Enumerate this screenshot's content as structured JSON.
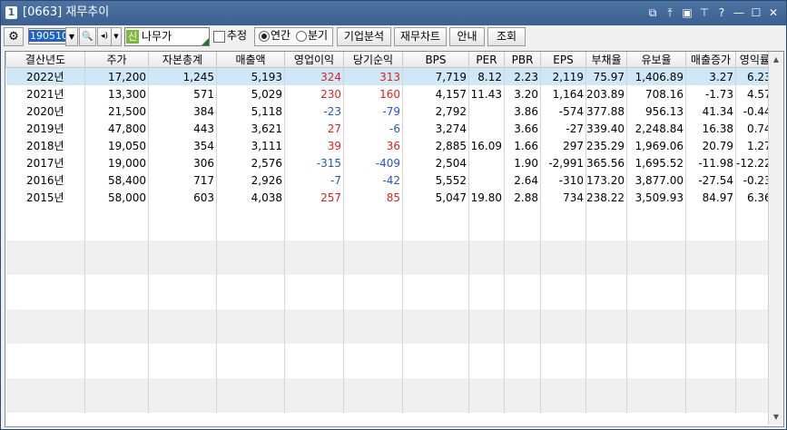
{
  "window": {
    "number": "1",
    "title": "[0663]  재무추이",
    "icons": [
      "⧉",
      "⤒",
      "▣",
      "⊤",
      "?",
      "—",
      "☐",
      "✕"
    ]
  },
  "toolbar": {
    "gear": "⚙",
    "stock_code": "190510",
    "dropdown": "▼",
    "search": "🔍",
    "sound": "◂)",
    "badge": "신",
    "stock_name": "나무가",
    "estimate_label": "추정",
    "annual_label": "연간",
    "quarter_label": "분기",
    "btn_company": "기업분석",
    "btn_chart": "재무차트",
    "btn_guide": "안내",
    "btn_query": "조회"
  },
  "table": {
    "headers": [
      "결산년도",
      "주가",
      "자본총계",
      "매출액",
      "영업이익",
      "당기순익",
      "BPS",
      "PER",
      "PBR",
      "EPS",
      "부채율",
      "유보율",
      "매출증가",
      "영익률"
    ],
    "rows": [
      {
        "year": "2022년",
        "price": "17,200",
        "equity": "1,245",
        "sales": "5,193",
        "op": "324",
        "net": "313",
        "bps": "7,719",
        "per": "8.12",
        "pbr": "2.23",
        "eps": "2,119",
        "debt": "75.97",
        "reserve": "1,406.89",
        "growth": "3.27",
        "opm": "6.23"
      },
      {
        "year": "2021년",
        "price": "13,300",
        "equity": "571",
        "sales": "5,029",
        "op": "230",
        "net": "160",
        "bps": "4,157",
        "per": "11.43",
        "pbr": "3.20",
        "eps": "1,164",
        "debt": "203.89",
        "reserve": "708.16",
        "growth": "-1.73",
        "opm": "4.57"
      },
      {
        "year": "2020년",
        "price": "21,500",
        "equity": "384",
        "sales": "5,118",
        "op": "-23",
        "net": "-79",
        "bps": "2,792",
        "per": "",
        "pbr": "3.86",
        "eps": "-574",
        "debt": "377.88",
        "reserve": "956.13",
        "growth": "41.34",
        "opm": "-0.44"
      },
      {
        "year": "2019년",
        "price": "47,800",
        "equity": "443",
        "sales": "3,621",
        "op": "27",
        "net": "-6",
        "bps": "3,274",
        "per": "",
        "pbr": "3.66",
        "eps": "-27",
        "debt": "339.40",
        "reserve": "2,248.84",
        "growth": "16.38",
        "opm": "0.74"
      },
      {
        "year": "2018년",
        "price": "19,050",
        "equity": "354",
        "sales": "3,111",
        "op": "39",
        "net": "36",
        "bps": "2,885",
        "per": "16.09",
        "pbr": "1.66",
        "eps": "297",
        "debt": "235.29",
        "reserve": "1,969.06",
        "growth": "20.79",
        "opm": "1.27"
      },
      {
        "year": "2017년",
        "price": "19,000",
        "equity": "306",
        "sales": "2,576",
        "op": "-315",
        "net": "-409",
        "bps": "2,504",
        "per": "",
        "pbr": "1.90",
        "eps": "-2,991",
        "debt": "365.56",
        "reserve": "1,695.52",
        "growth": "-11.98",
        "opm": "-12.22"
      },
      {
        "year": "2016년",
        "price": "58,400",
        "equity": "717",
        "sales": "2,926",
        "op": "-7",
        "net": "-42",
        "bps": "5,552",
        "per": "",
        "pbr": "2.64",
        "eps": "-310",
        "debt": "173.20",
        "reserve": "3,877.00",
        "growth": "-27.54",
        "opm": "-0.23"
      },
      {
        "year": "2015년",
        "price": "58,000",
        "equity": "603",
        "sales": "4,038",
        "op": "257",
        "net": "85",
        "bps": "5,047",
        "per": "19.80",
        "pbr": "2.88",
        "eps": "734",
        "debt": "238.22",
        "reserve": "3,509.93",
        "growth": "84.97",
        "opm": "6.36"
      }
    ]
  },
  "colors": {
    "title_bar": "#4c73a3",
    "selected_row": "#cfe8f7",
    "positive": "#e0201e",
    "negative": "#2255cc"
  }
}
